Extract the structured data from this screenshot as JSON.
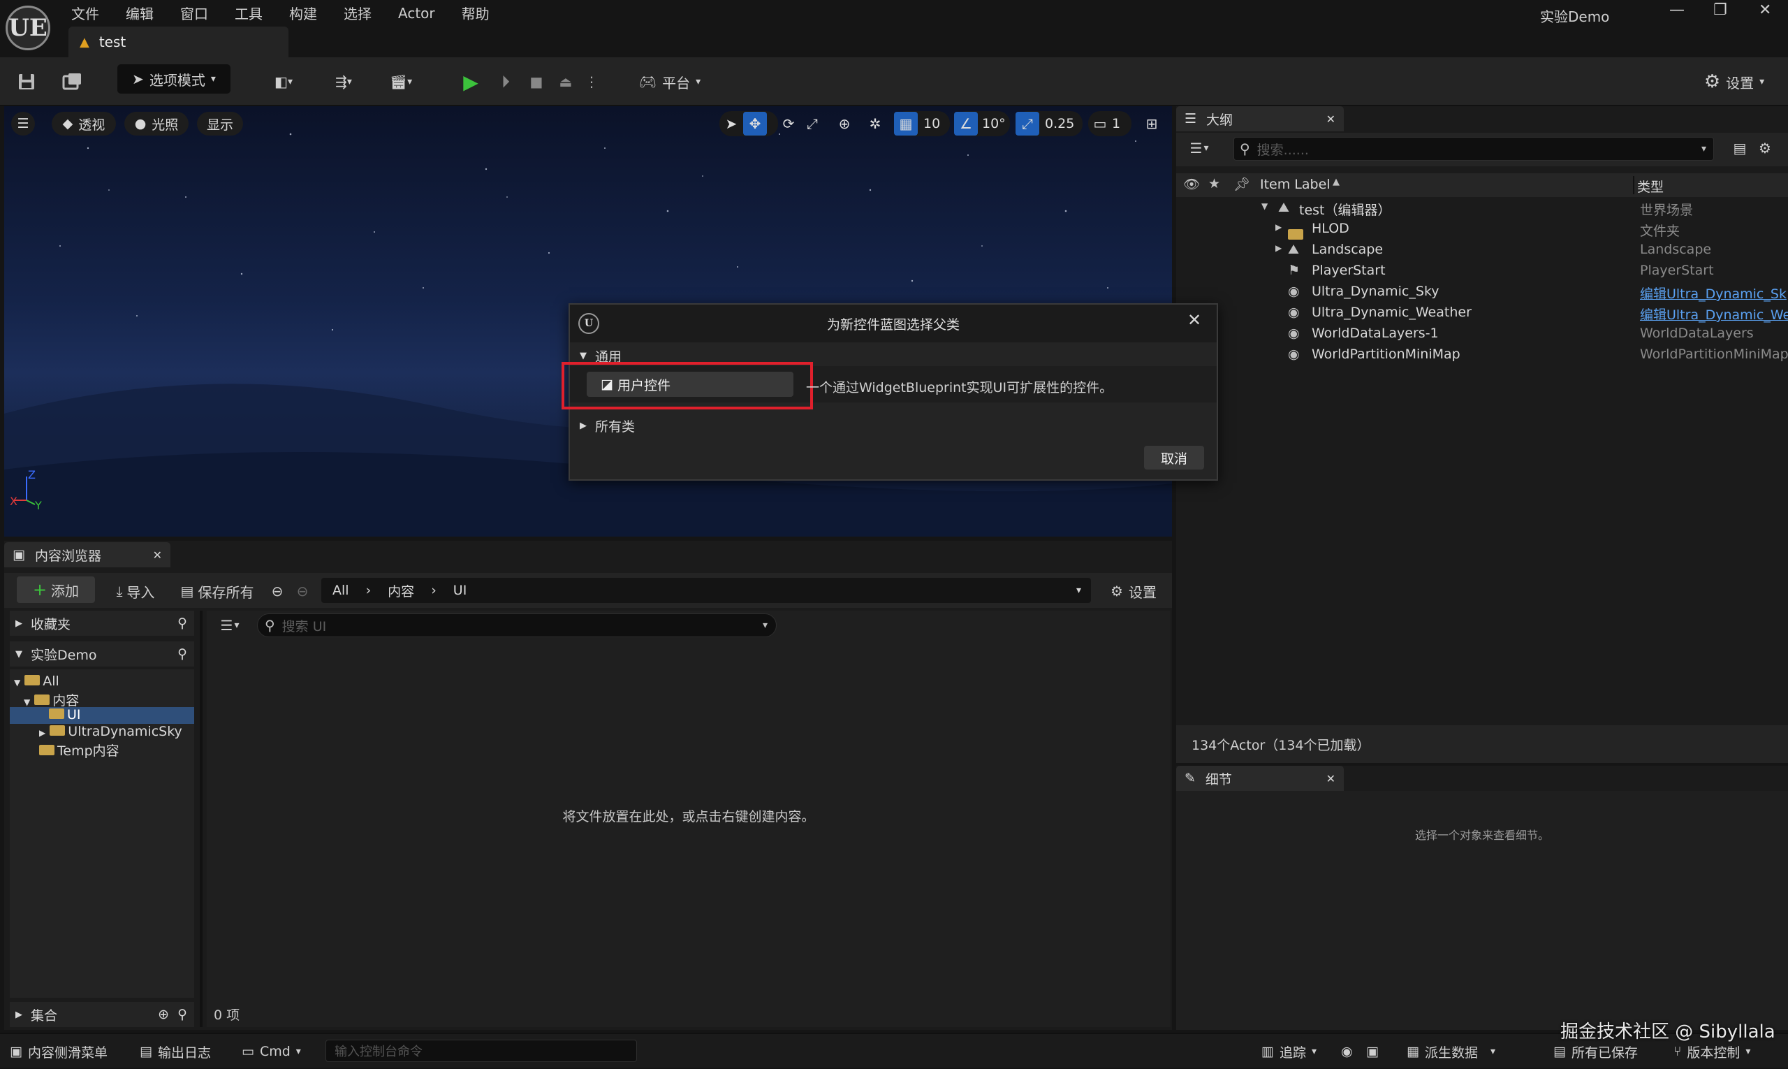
{
  "app": {
    "logo": "UE",
    "menu": [
      "文件",
      "编辑",
      "窗口",
      "工具",
      "构建",
      "选择",
      "Actor",
      "帮助"
    ],
    "project_title": "实验Demo",
    "doc_tab": "test"
  },
  "toolbar": {
    "mode_label": "选项模式",
    "platform_label": "平台",
    "settings_label": "设置"
  },
  "viewport": {
    "perspective": "透视",
    "lighting": "光照",
    "show": "显示",
    "grid_snap": "10",
    "rotation_snap": "10°",
    "scale_snap": "0.25",
    "camera_speed": "1",
    "axis_z": "Z",
    "axis_y": "Y",
    "axis_x": "X"
  },
  "dialog": {
    "title": "为新控件蓝图选择父类",
    "section_common": "通用",
    "user_widget_label": "用户控件",
    "user_widget_desc": "一个通过WidgetBlueprint实现UI可扩展性的控件。",
    "section_all": "所有类",
    "cancel": "取消",
    "highlight_color": "#e0202c"
  },
  "outliner": {
    "tab_label": "大纲",
    "search_placeholder": "搜索......",
    "col_label": "Item Label",
    "col_type": "类型",
    "rows": [
      {
        "label": "test（编辑器）",
        "type": "世界场景"
      },
      {
        "label": "HLOD",
        "type": "文件夹"
      },
      {
        "label": "Landscape",
        "type": "Landscape"
      },
      {
        "label": "PlayerStart",
        "type": "PlayerStart"
      },
      {
        "label": "Ultra_Dynamic_Sky",
        "type": "编辑Ultra_Dynamic_Sk"
      },
      {
        "label": "Ultra_Dynamic_Weather",
        "type": "编辑Ultra_Dynamic_We"
      },
      {
        "label": "WorldDataLayers-1",
        "type": "WorldDataLayers"
      },
      {
        "label": "WorldPartitionMiniMap",
        "type": "WorldPartitionMiniMap"
      }
    ],
    "footer": "134个Actor（134个已加载）"
  },
  "details": {
    "tab_label": "细节",
    "empty_text": "选择一个对象来查看细节。"
  },
  "content_browser": {
    "tab_label": "内容浏览器",
    "add": "添加",
    "import": "导入",
    "save_all": "保存所有",
    "path": [
      "All",
      "内容",
      "UI"
    ],
    "settings": "设置",
    "favorites": "收藏夹",
    "project": "实验Demo",
    "tree": [
      "All",
      "内容",
      "UI",
      "UltraDynamicSky",
      "Temp内容"
    ],
    "search_placeholder": "搜索 UI",
    "empty_text": "将文件放置在此处，或点击右键创建内容。",
    "collections": "集合",
    "item_count": "0 项"
  },
  "statusbar": {
    "content_drawer": "内容侧滑菜单",
    "output_log": "输出日志",
    "cmd": "Cmd",
    "cmd_placeholder": "输入控制台命令",
    "trace": "追踪",
    "derived_data": "派生数据",
    "all_saved": "所有已保存",
    "source_control": "版本控制"
  },
  "watermark": "掘金技术社区 @ Sibyllala"
}
